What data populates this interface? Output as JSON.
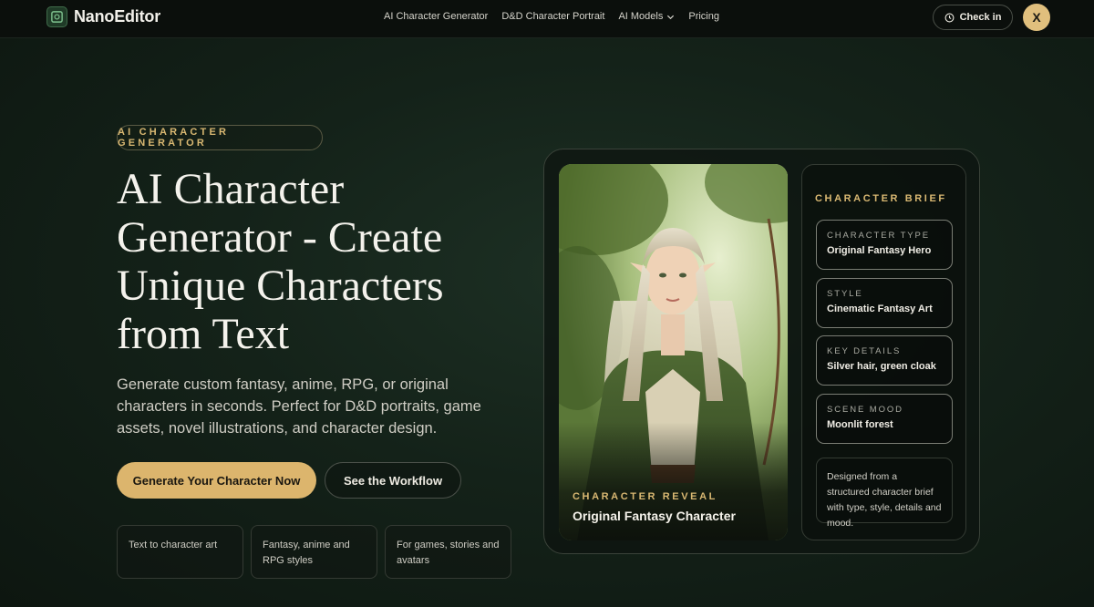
{
  "nav": {
    "brand": "NanoEditor",
    "links": [
      "AI Character Generator",
      "D&D Character Portrait",
      "AI Models",
      "Pricing"
    ],
    "checkin_label": "Check in",
    "avatar_initial": "X"
  },
  "hero": {
    "eyebrow": "AI CHARACTER GENERATOR",
    "title": "AI Character Generator - Create Unique Characters from Text",
    "lead": "Generate custom fantasy, anime, RPG, or original characters in seconds. Perfect for D&D portraits, game assets, novel illustrations, and character design.",
    "primary_cta": "Generate Your Character Now",
    "secondary_cta": "See the Workflow",
    "features": [
      "Text to character art",
      "Fantasy, anime and RPG styles",
      "For games, stories and avatars"
    ]
  },
  "showcase": {
    "reveal_label": "CHARACTER REVEAL",
    "reveal_title": "Original Fantasy Character",
    "brief_heading": "CHARACTER BRIEF",
    "brief": [
      {
        "key": "CHARACTER TYPE",
        "value": "Original Fantasy Hero"
      },
      {
        "key": "STYLE",
        "value": "Cinematic Fantasy Art"
      },
      {
        "key": "KEY DETAILS",
        "value": "Silver hair, green cloak"
      },
      {
        "key": "SCENE MOOD",
        "value": "Moonlit forest"
      }
    ],
    "note": "Designed from a structured character brief with type, style, details and mood."
  },
  "colors": {
    "accent_gold": "#dcb56d",
    "background_green": "#142219",
    "nav_bg": "#0b0f0c"
  }
}
